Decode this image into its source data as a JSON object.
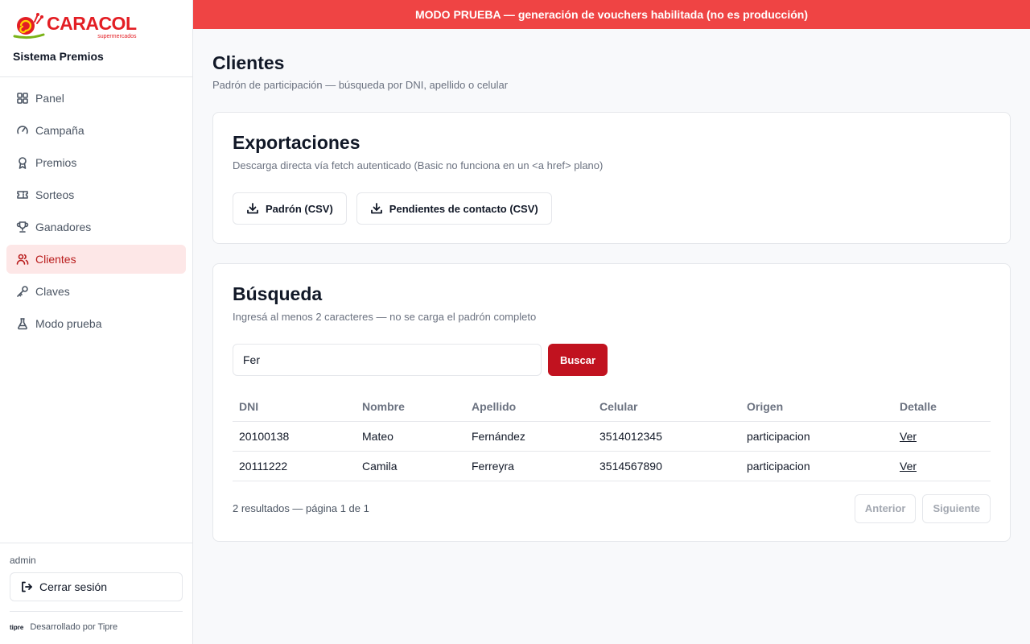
{
  "brand": {
    "logo_text": "CARACOL",
    "logo_sub": "supermercados",
    "app_title": "Sistema Premios",
    "accent": "#e31e24"
  },
  "banner": {
    "text": "MODO PRUEBA — generación de vouchers habilitada (no es producción)",
    "color": "#ef4444"
  },
  "nav": {
    "items": [
      {
        "label": "Panel",
        "icon": "grid-icon"
      },
      {
        "label": "Campaña",
        "icon": "gauge-icon"
      },
      {
        "label": "Premios",
        "icon": "award-icon"
      },
      {
        "label": "Sorteos",
        "icon": "ticket-icon"
      },
      {
        "label": "Ganadores",
        "icon": "trophy-icon"
      },
      {
        "label": "Clientes",
        "icon": "users-icon",
        "active": true
      },
      {
        "label": "Claves",
        "icon": "key-icon"
      },
      {
        "label": "Modo prueba",
        "icon": "flask-icon"
      }
    ]
  },
  "sidebar_footer": {
    "user": "admin",
    "logout_label": "Cerrar sesión",
    "dev_logo": "tipre",
    "dev_text": "Desarrollado por Tipre"
  },
  "page": {
    "title": "Clientes",
    "subtitle": "Padrón de participación — búsqueda por DNI, apellido o celular"
  },
  "exports": {
    "title": "Exportaciones",
    "subtitle": "Descarga directa vía fetch autenticado (Basic no funciona en un <a href> plano)",
    "btn_padron": "Padrón (CSV)",
    "btn_pendientes": "Pendientes de contacto (CSV)"
  },
  "search": {
    "title": "Búsqueda",
    "subtitle": "Ingresá al menos 2 caracteres — no se carga el padrón completo",
    "value": "Fer",
    "button": "Buscar",
    "button_color": "#c1121f"
  },
  "table": {
    "headers": {
      "dni": "DNI",
      "nombre": "Nombre",
      "apellido": "Apellido",
      "celular": "Celular",
      "origen": "Origen",
      "detalle": "Detalle"
    },
    "rows": [
      {
        "dni": "20100138",
        "nombre": "Mateo",
        "apellido": "Fernández",
        "celular": "3514012345",
        "origen": "participacion",
        "detalle": "Ver"
      },
      {
        "dni": "20111222",
        "nombre": "Camila",
        "apellido": "Ferreyra",
        "celular": "3514567890",
        "origen": "participacion",
        "detalle": "Ver"
      }
    ]
  },
  "pager": {
    "text": "2 resultados — página 1 de 1",
    "prev": "Anterior",
    "next": "Siguiente"
  }
}
